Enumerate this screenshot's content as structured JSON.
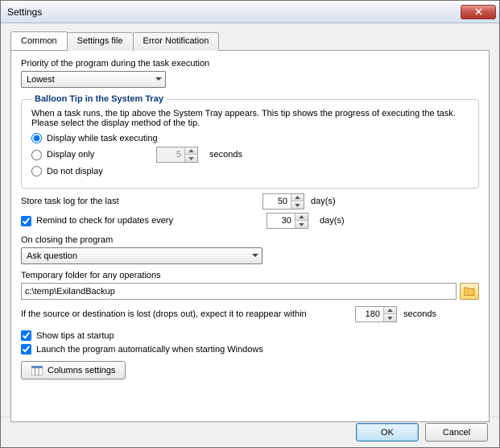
{
  "window": {
    "title": "Settings"
  },
  "tabs": {
    "t0": "Common",
    "t1": "Settings file",
    "t2": "Error Notification"
  },
  "priority": {
    "label": "Priority of the program during the task execution",
    "value": "Lowest"
  },
  "balloon": {
    "legend": "Balloon Tip in the System Tray",
    "desc": "When a task runs, the tip above the System Tray appears. This tip shows the progress of executing the task. Please select the display method of the tip.",
    "opt1": "Display while task executing",
    "opt2": "Display only",
    "opt2_value": "5",
    "opt2_unit": "seconds",
    "opt3": "Do not display"
  },
  "storelog": {
    "label": "Store task log for the last",
    "value": "50",
    "unit": "day(s)"
  },
  "updates": {
    "label": "Remind to check for updates every",
    "value": "30",
    "unit": "day(s)"
  },
  "onclose": {
    "label": "On closing the program",
    "value": "Ask question"
  },
  "tempfolder": {
    "label": "Temporary folder for any operations",
    "value": "c:\\temp\\ExilandBackup"
  },
  "reappear": {
    "label": "If the source or destination is lost (drops out), expect it to reappear within",
    "value": "180",
    "unit": "seconds"
  },
  "showtips": {
    "label": "Show tips at startup"
  },
  "autostart": {
    "label": "Launch the program automatically when starting Windows"
  },
  "columns": {
    "label": "Columns settings"
  },
  "footer": {
    "ok": "OK",
    "cancel": "Cancel"
  }
}
